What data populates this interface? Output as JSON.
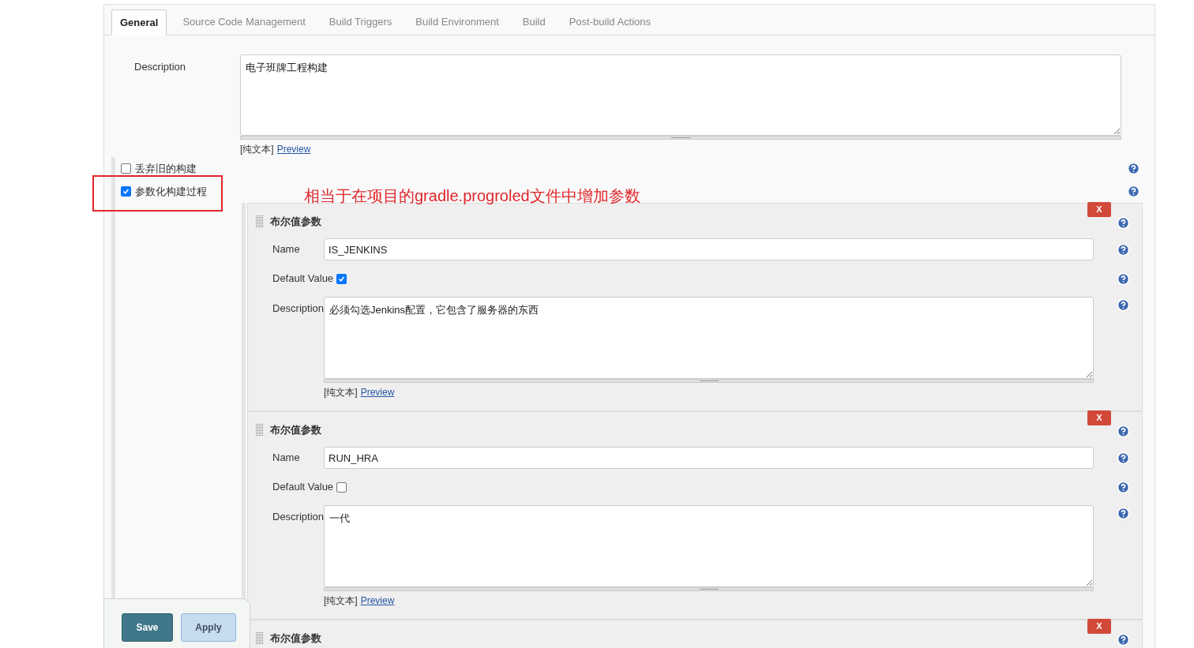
{
  "tabs": [
    {
      "label": "General",
      "selected": true
    },
    {
      "label": "Source Code Management",
      "selected": false
    },
    {
      "label": "Build Triggers",
      "selected": false
    },
    {
      "label": "Build Environment",
      "selected": false
    },
    {
      "label": "Build",
      "selected": false
    },
    {
      "label": "Post-build Actions",
      "selected": false
    }
  ],
  "description": {
    "label": "Description",
    "value": "电子班牌工程构建",
    "format_label": "[纯文本]",
    "preview_link": "Preview"
  },
  "options": [
    {
      "label": "丢弃旧的构建",
      "checked": false,
      "highlighted": false
    },
    {
      "label": "参数化构建过程",
      "checked": true,
      "highlighted": true
    }
  ],
  "annotation": "相当于在项目的gradle.progroled文件中增加参数",
  "parameters": [
    {
      "title": "布尔值参数",
      "delete_button": "X",
      "name_label": "Name",
      "name": "IS_JENKINS",
      "default_label": "Default Value",
      "default_value": true,
      "description_label": "Description",
      "description": "必须勾选Jenkins配置，它包含了服务器的东西",
      "format_label": "[纯文本]",
      "preview_link": "Preview"
    },
    {
      "title": "布尔值参数",
      "delete_button": "X",
      "name_label": "Name",
      "name": "RUN_HRA",
      "default_label": "Default Value",
      "default_value": false,
      "description_label": "Description",
      "description": "一代",
      "format_label": "[纯文本]",
      "preview_link": "Preview"
    },
    {
      "title": "布尔值参数",
      "delete_button": "X"
    }
  ],
  "buttons": [
    {
      "label": "Save",
      "kind": "primary"
    },
    {
      "label": "Apply",
      "kind": "secondary"
    }
  ]
}
